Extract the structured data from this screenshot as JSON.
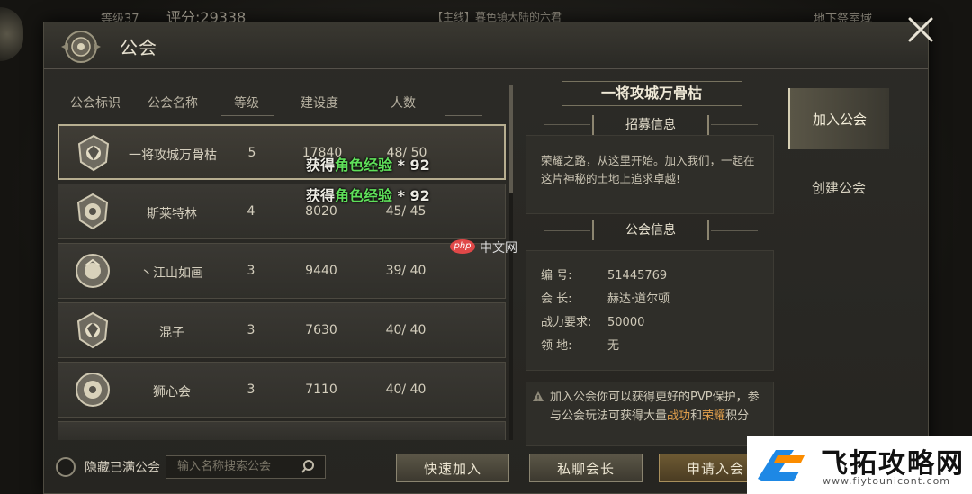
{
  "hud": {
    "level": "等级37",
    "power": "评分:29338",
    "event": "【主线】暮色镇大陆的六君",
    "zone": "地下祭室域"
  },
  "window": {
    "title": "公会",
    "close_icon": "close-icon"
  },
  "guild_list": {
    "headers": {
      "emblem": "公会标识",
      "name": "公会名称",
      "level": "等级",
      "build": "建设度",
      "members": "人数"
    },
    "rows": [
      {
        "name": "一将攻城万骨枯",
        "level": "5",
        "build": "17840",
        "members": "48/ 50"
      },
      {
        "name": "斯莱特林",
        "level": "4",
        "build": "8020",
        "members": "45/ 45"
      },
      {
        "name": "丶江山如画",
        "level": "3",
        "build": "9440",
        "members": "39/ 40"
      },
      {
        "name": "混子",
        "level": "3",
        "build": "7630",
        "members": "40/ 40"
      },
      {
        "name": "狮心会",
        "level": "3",
        "build": "7110",
        "members": "40/ 40"
      }
    ]
  },
  "xp_popups": [
    {
      "prefix": "获得",
      "highlight": "角色经验",
      "suffix": " * 92"
    },
    {
      "prefix": "获得",
      "highlight": "角色经验",
      "suffix": " * 92"
    }
  ],
  "bottom": {
    "hide_full": "隐藏已满公会",
    "search_placeholder": "输入名称搜索公会",
    "quick_join": "快速加入",
    "private_chat": "私聊会长",
    "apply_join": "申请入会"
  },
  "info": {
    "guild_name": "一将攻城万骨枯",
    "recruit_title": "招募信息",
    "recruit_text": "荣耀之路，从这里开始。加入我们，一起在这片神秘的土地上追求卓越!",
    "guild_info_title": "公会信息",
    "id_label": "编    号:",
    "id_value": "51445769",
    "leader_label": "会    长:",
    "leader_value": "赫达·道尔顿",
    "power_label": "战力要求:",
    "power_value": "50000",
    "territory_label": "领    地:",
    "territory_value": "无",
    "tip_part1": "加入公会你可以获得更好的PVP保护，参与公会玩法可获得大量",
    "tip_hl1": "战功",
    "tip_part2": "和",
    "tip_hl2": "荣耀",
    "tip_part3": "积分"
  },
  "tabs": {
    "join": "加入公会",
    "create": "创建公会"
  },
  "watermarks": {
    "php_badge": "php",
    "php_text": "中文网",
    "site_name": "飞拓攻略网",
    "site_url": "www.fiytounicont.com"
  }
}
